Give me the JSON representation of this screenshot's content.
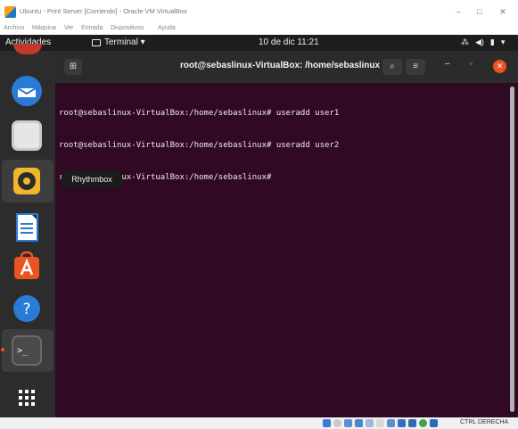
{
  "host_window": {
    "title": "Ubuntu - Print Server [Corriendo] - Oracle VM VirtualBox",
    "minimize": "–",
    "maximize": "□",
    "close": "✕"
  },
  "vbox_menu": [
    "Archivo",
    "Máquina",
    "Ver",
    "Entrada",
    "Dispositivos",
    "Ayuda"
  ],
  "ubuntu_bar": {
    "activities": "Actividades",
    "app_menu": "Terminal ▾",
    "clock": "10 de dic  11:21",
    "tray_icons": [
      "network-icon",
      "volume-icon",
      "battery-icon",
      "system-menu-icon"
    ]
  },
  "dock": {
    "items": [
      {
        "name": "thunderbird-icon",
        "color": "#2a7bd8"
      },
      {
        "name": "files-icon",
        "color": "#e6e6e6"
      },
      {
        "name": "rhythmbox-icon",
        "color": "#f2b62c"
      },
      {
        "name": "libreoffice-writer-icon",
        "color": "#2a7bd8"
      },
      {
        "name": "ubuntu-software-icon",
        "color": "#e95420"
      },
      {
        "name": "help-icon",
        "color": "#2a7bd8"
      },
      {
        "name": "terminal-icon",
        "color": "#4a4a4a"
      },
      {
        "name": "show-applications-icon",
        "color": "#ffffff"
      }
    ],
    "tooltip": "Rhythmbox"
  },
  "terminal": {
    "title": "root@sebaslinux-VirtualBox: /home/sebaslinux",
    "lines": [
      "root@sebaslinux-VirtualBox:/home/sebaslinux# useradd user1",
      "root@sebaslinux-VirtualBox:/home/sebaslinux# useradd user2",
      "root@sebaslinux-VirtualBox:/home/sebaslinux#"
    ]
  },
  "status_bar": {
    "host_key": "CTRL DERECHA"
  },
  "colors": {
    "terminal_bg": "#300a24",
    "accent": "#e95420",
    "dock_bg": "#2c2c2c",
    "topbar_bg": "#1d1d1d"
  }
}
